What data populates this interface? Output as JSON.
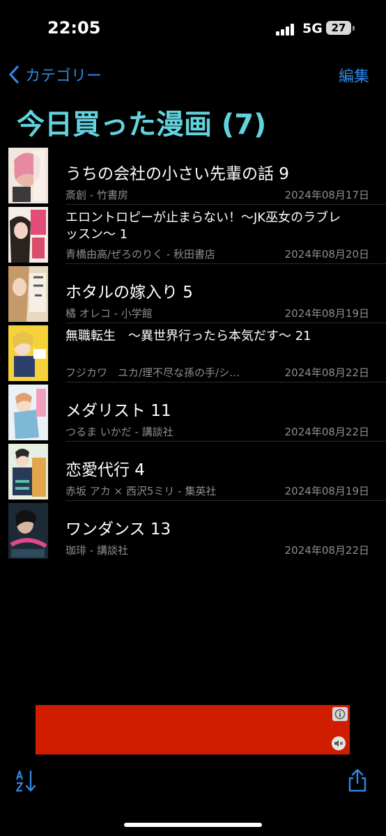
{
  "status_bar": {
    "time": "22:05",
    "network": "5G",
    "battery": "27"
  },
  "nav": {
    "back_label": "カテゴリー",
    "edit_label": "編集"
  },
  "page": {
    "title": "今日買った漫画 (7)"
  },
  "books": [
    {
      "title": "うちの会社の小さい先輩の話 9",
      "author": "斎創 - 竹書房",
      "date": "2024年08月17日"
    },
    {
      "title": "エロントロピーが止まらない！〜JK巫女のラブレッスン〜 1",
      "author": "青橋由高/ぜろのりく - 秋田書店",
      "date": "2024年08月20日"
    },
    {
      "title": "ホタルの嫁入り 5",
      "author": "橘 オレコ - 小学館",
      "date": "2024年08月19日"
    },
    {
      "title": "無職転生　〜異世界行ったら本気だす〜 21",
      "author": "フジカワ　ユカ/理不尽な孫の手/シ…",
      "date": "2024年08月22日"
    },
    {
      "title": "メダリスト 11",
      "author": "つるま いかだ - 講談社",
      "date": "2024年08月22日"
    },
    {
      "title": "恋愛代行 4",
      "author": "赤坂 アカ × 西沢5ミリ - 集英社",
      "date": "2024年08月19日"
    },
    {
      "title": "ワンダンス 13",
      "author": "珈琲 - 講談社",
      "date": "2024年08月22日"
    }
  ],
  "colors": {
    "accent": "#2f87e6",
    "title": "#62d3de",
    "ad": "#d01d00",
    "secondary_text": "#8e8e93"
  },
  "icons": {
    "back": "chevron-left-icon",
    "sort": "sort-az-icon",
    "share": "share-icon",
    "ad_info": "info-icon",
    "ad_mute": "mute-icon"
  }
}
